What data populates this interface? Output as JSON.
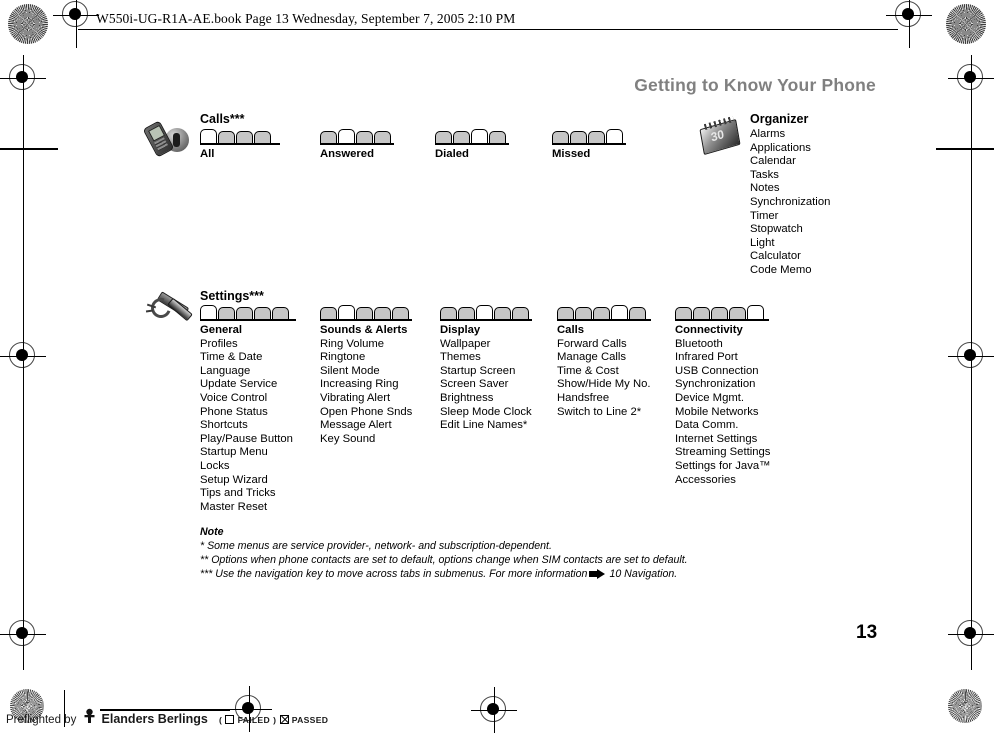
{
  "header": {
    "file_line": "W550i-UG-R1A-AE.book  Page 13  Wednesday, September 7, 2005  2:10 PM",
    "chapter_title": "Getting to Know Your Phone"
  },
  "sections": [
    {
      "id": "calls",
      "icon": "phone-call-icon",
      "title": "Calls***",
      "columns": [
        {
          "label": "All",
          "tabs_total": 4,
          "tab_selected": 1,
          "items": []
        },
        {
          "label": "Answered",
          "tabs_total": 4,
          "tab_selected": 2,
          "items": []
        },
        {
          "label": "Dialed",
          "tabs_total": 4,
          "tab_selected": 3,
          "items": []
        },
        {
          "label": "Missed",
          "tabs_total": 4,
          "tab_selected": 4,
          "items": []
        }
      ]
    },
    {
      "id": "settings",
      "icon": "tools-settings-icon",
      "title": "Settings***",
      "columns": [
        {
          "label": "General",
          "tabs_total": 5,
          "tab_selected": 1,
          "items": [
            "Profiles",
            "Time & Date",
            "Language",
            "Update Service",
            "Voice Control",
            "Phone Status",
            "Shortcuts",
            "Play/Pause Button",
            "Startup Menu",
            "Locks",
            "Setup Wizard",
            "Tips and Tricks",
            "Master Reset"
          ]
        },
        {
          "label": "Sounds & Alerts",
          "tabs_total": 5,
          "tab_selected": 2,
          "items": [
            "Ring Volume",
            "Ringtone",
            "Silent Mode",
            "Increasing Ring",
            "Vibrating Alert",
            "Open Phone Snds",
            "Message Alert",
            "Key Sound"
          ]
        },
        {
          "label": "Display",
          "tabs_total": 5,
          "tab_selected": 3,
          "items": [
            "Wallpaper",
            "Themes",
            "Startup Screen",
            "Screen Saver",
            "Brightness",
            "Sleep Mode Clock",
            "Edit Line Names*"
          ]
        },
        {
          "label": "Calls",
          "tabs_total": 5,
          "tab_selected": 4,
          "items": [
            "Forward Calls",
            "Manage Calls",
            "Time & Cost",
            "Show/Hide My No.",
            "Handsfree",
            "Switch to Line 2*"
          ]
        },
        {
          "label": "Connectivity",
          "tabs_total": 5,
          "tab_selected": 5,
          "items": [
            "Bluetooth",
            "Infrared Port",
            "USB Connection",
            "Synchronization",
            "Device Mgmt.",
            "Mobile Networks",
            "Data Comm.",
            "Internet Settings",
            "Streaming Settings",
            "Settings for Java™",
            "Accessories"
          ]
        }
      ]
    }
  ],
  "organizer": {
    "icon": "calendar-organizer-icon",
    "title": "Organizer",
    "items": [
      "Alarms",
      "Applications",
      "Calendar",
      "Tasks",
      "Notes",
      "Synchronization",
      "Timer",
      "Stopwatch",
      "Light",
      "Calculator",
      "Code Memo"
    ]
  },
  "note": {
    "title": "Note",
    "lines": [
      "* Some menus are service provider-, network- and subscription-dependent.",
      "** Options when phone contacts are set to default, options change when SIM contacts are set to default."
    ],
    "last_line_prefix": "*** Use the navigation key to move across tabs in submenus. For more information",
    "last_line_suffix": "10 Navigation."
  },
  "page_number": "13",
  "footer": {
    "prefix": "Preflighted by",
    "brand": "Elanders Berlings",
    "paren_open": "(",
    "failed_label": "FAILED",
    "paren_close": ")",
    "passed_label": "PASSED"
  },
  "colors": {
    "chapter_title": "#808080",
    "tab_fill": "#c6c6c6",
    "tab_selected_fill": "#ffffff",
    "ink": "#000000"
  }
}
